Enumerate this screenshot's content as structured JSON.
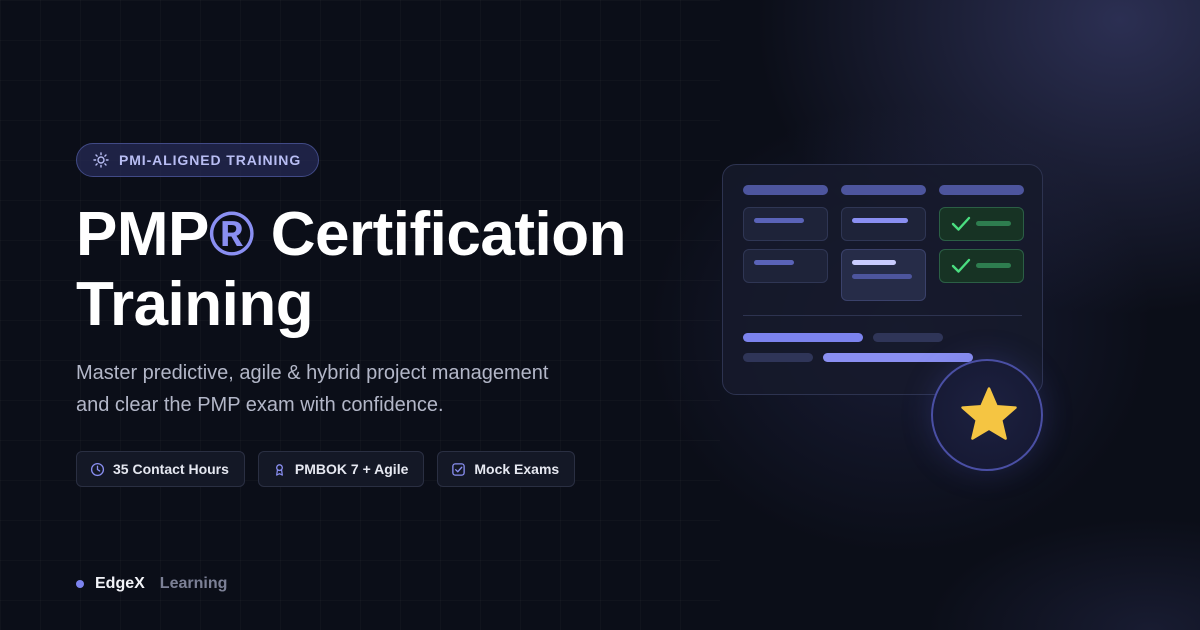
{
  "badge": {
    "icon": "sun-icon",
    "text": "PMI-ALIGNED TRAINING"
  },
  "hero": {
    "title_line1_part1": "PMP",
    "title_registered_mark": "®",
    "title_line1_part2": " Certification",
    "title_line2": "Training",
    "subtitle_line1": "Master predictive, agile & hybrid project management",
    "subtitle_line2": "and clear the PMP exam with confidence."
  },
  "features": [
    {
      "icon": "clock-icon",
      "label": "35 Contact Hours"
    },
    {
      "icon": "award-icon",
      "label": "PMBOK 7 + Agile"
    },
    {
      "icon": "checkbox-icon",
      "label": "Mock Exams"
    }
  ],
  "brand": {
    "name": "EdgeX",
    "suffix": "Learning"
  },
  "illustration": {
    "badge_icon": "star-icon",
    "row_status_icon": "check-icon"
  },
  "colors": {
    "background": "#0b0e18",
    "accent": "#8a8ff2",
    "success": "#4ade80",
    "star": "#f5c542"
  }
}
